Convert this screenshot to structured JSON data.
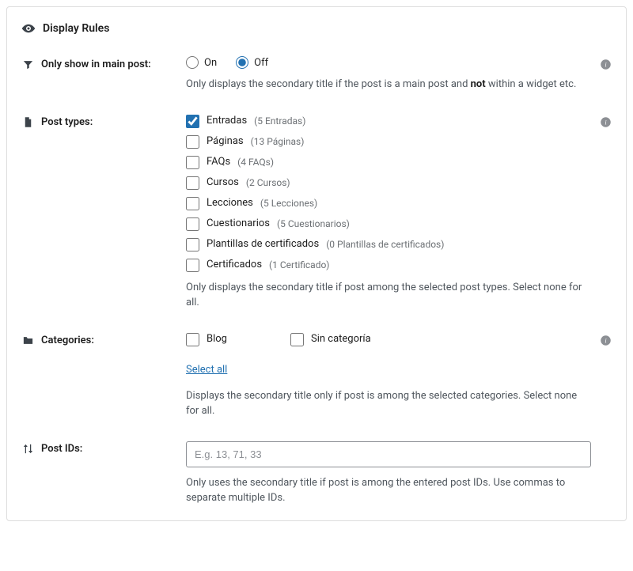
{
  "section_title": "Display Rules",
  "only_main": {
    "label": "Only show in main post:",
    "on": "On",
    "off": "Off",
    "desc_pre": "Only displays the secondary title if the post is a main post and ",
    "desc_strong": "not",
    "desc_post": " within a widget etc."
  },
  "post_types": {
    "label": "Post types:",
    "items": [
      {
        "name": "Entradas",
        "count": "(5 Entradas)",
        "checked": true
      },
      {
        "name": "Páginas",
        "count": "(13 Páginas)",
        "checked": false
      },
      {
        "name": "FAQs",
        "count": "(4 FAQs)",
        "checked": false
      },
      {
        "name": "Cursos",
        "count": "(2 Cursos)",
        "checked": false
      },
      {
        "name": "Lecciones",
        "count": "(5 Lecciones)",
        "checked": false
      },
      {
        "name": "Cuestionarios",
        "count": "(5 Cuestionarios)",
        "checked": false
      },
      {
        "name": "Plantillas de certificados",
        "count": "(0 Plantillas de certificados)",
        "checked": false
      },
      {
        "name": "Certificados",
        "count": "(1 Certificado)",
        "checked": false
      }
    ],
    "desc": "Only displays the secondary title if post among the selected post types. Select none for all."
  },
  "categories": {
    "label": "Categories:",
    "items": [
      {
        "name": "Blog",
        "checked": false
      },
      {
        "name": "Sin categoría",
        "checked": false
      }
    ],
    "select_all": "Select all",
    "desc": "Displays the secondary title only if post is among the selected categories. Select none for all."
  },
  "post_ids": {
    "label": "Post IDs:",
    "placeholder": "E.g. 13, 71, 33",
    "value": "",
    "desc": "Only uses the secondary title if post is among the entered post IDs. Use commas to separate multiple IDs."
  }
}
